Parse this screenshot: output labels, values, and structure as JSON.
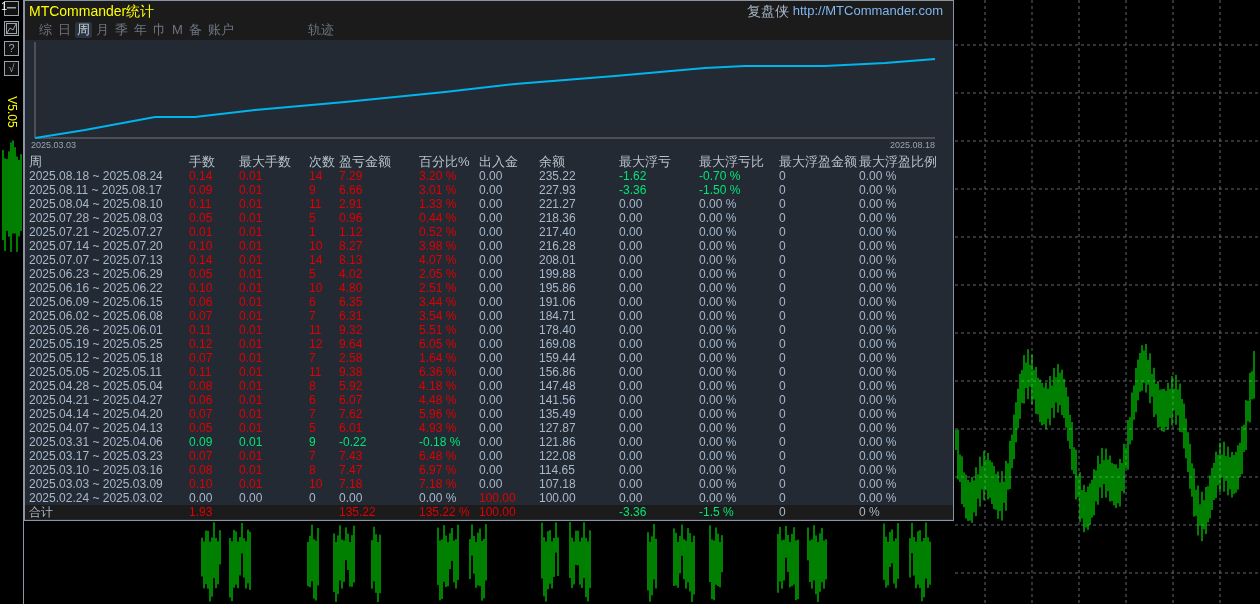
{
  "app": {
    "title": "MTCommander统计",
    "brand": "复盘侠",
    "link": "http://MTCommander.com",
    "version": "V5.05",
    "corner_label": "1"
  },
  "toolbar": [
    {
      "kind": "minimize"
    },
    {
      "kind": "image"
    },
    {
      "kind": "text",
      "label": "?"
    },
    {
      "kind": "text",
      "label": "√"
    }
  ],
  "tabs": [
    {
      "label": "综",
      "selected": false
    },
    {
      "label": "日",
      "selected": false
    },
    {
      "label": "周",
      "selected": true
    },
    {
      "label": "月",
      "selected": false
    },
    {
      "label": "季",
      "selected": false
    },
    {
      "label": "年",
      "selected": false
    },
    {
      "label": "巾",
      "selected": false
    },
    {
      "label": "M",
      "selected": false
    },
    {
      "label": "备",
      "selected": false
    },
    {
      "label": "账户",
      "selected": false
    },
    {
      "label": "轨迹",
      "selected": false,
      "kind": "far"
    }
  ],
  "equity_chart": {
    "start_label": "2025.03.03",
    "end_label": "2025.08.18"
  },
  "table": {
    "columns": [
      "周",
      "手数",
      "最大手数",
      "次数",
      "盈亏金额",
      "百分比%",
      "出入金",
      "余额",
      "最大浮亏",
      "最大浮亏比",
      "最大浮盈金额",
      "最大浮盈比例"
    ],
    "rows": [
      {
        "kind": "profit",
        "deposit": false,
        "floating_loss": true,
        "cells": [
          "2025.08.18 ~ 2025.08.24",
          "0.14",
          "0.01",
          "14",
          "7.29",
          "3.20 %",
          "0.00",
          "235.22",
          "-1.62",
          "-0.70 %",
          "0",
          "0.00 %"
        ]
      },
      {
        "kind": "profit",
        "deposit": false,
        "floating_loss": true,
        "cells": [
          "2025.08.11 ~ 2025.08.17",
          "0.09",
          "0.01",
          "9",
          "6.66",
          "3.01 %",
          "0.00",
          "227.93",
          "-3.36",
          "-1.50 %",
          "0",
          "0.00 %"
        ]
      },
      {
        "kind": "profit",
        "deposit": false,
        "floating_loss": false,
        "cells": [
          "2025.08.04 ~ 2025.08.10",
          "0.11",
          "0.01",
          "11",
          "2.91",
          "1.33 %",
          "0.00",
          "221.27",
          "0.00",
          "0.00 %",
          "0",
          "0.00 %"
        ]
      },
      {
        "kind": "profit",
        "deposit": false,
        "floating_loss": false,
        "cells": [
          "2025.07.28 ~ 2025.08.03",
          "0.05",
          "0.01",
          "5",
          "0.96",
          "0.44 %",
          "0.00",
          "218.36",
          "0.00",
          "0.00 %",
          "0",
          "0.00 %"
        ]
      },
      {
        "kind": "profit",
        "deposit": false,
        "floating_loss": false,
        "cells": [
          "2025.07.21 ~ 2025.07.27",
          "0.01",
          "0.01",
          "1",
          "1.12",
          "0.52 %",
          "0.00",
          "217.40",
          "0.00",
          "0.00 %",
          "0",
          "0.00 %"
        ]
      },
      {
        "kind": "profit",
        "deposit": false,
        "floating_loss": false,
        "cells": [
          "2025.07.14 ~ 2025.07.20",
          "0.10",
          "0.01",
          "10",
          "8.27",
          "3.98 %",
          "0.00",
          "216.28",
          "0.00",
          "0.00 %",
          "0",
          "0.00 %"
        ]
      },
      {
        "kind": "profit",
        "deposit": false,
        "floating_loss": false,
        "cells": [
          "2025.07.07 ~ 2025.07.13",
          "0.14",
          "0.01",
          "14",
          "8.13",
          "4.07 %",
          "0.00",
          "208.01",
          "0.00",
          "0.00 %",
          "0",
          "0.00 %"
        ]
      },
      {
        "kind": "profit",
        "deposit": false,
        "floating_loss": false,
        "cells": [
          "2025.06.23 ~ 2025.06.29",
          "0.05",
          "0.01",
          "5",
          "4.02",
          "2.05 %",
          "0.00",
          "199.88",
          "0.00",
          "0.00 %",
          "0",
          "0.00 %"
        ]
      },
      {
        "kind": "profit",
        "deposit": false,
        "floating_loss": false,
        "cells": [
          "2025.06.16 ~ 2025.06.22",
          "0.10",
          "0.01",
          "10",
          "4.80",
          "2.51 %",
          "0.00",
          "195.86",
          "0.00",
          "0.00 %",
          "0",
          "0.00 %"
        ]
      },
      {
        "kind": "profit",
        "deposit": false,
        "floating_loss": false,
        "cells": [
          "2025.06.09 ~ 2025.06.15",
          "0.06",
          "0.01",
          "6",
          "6.35",
          "3.44 %",
          "0.00",
          "191.06",
          "0.00",
          "0.00 %",
          "0",
          "0.00 %"
        ]
      },
      {
        "kind": "profit",
        "deposit": false,
        "floating_loss": false,
        "cells": [
          "2025.06.02 ~ 2025.06.08",
          "0.07",
          "0.01",
          "7",
          "6.31",
          "3.54 %",
          "0.00",
          "184.71",
          "0.00",
          "0.00 %",
          "0",
          "0.00 %"
        ]
      },
      {
        "kind": "profit",
        "deposit": false,
        "floating_loss": false,
        "cells": [
          "2025.05.26 ~ 2025.06.01",
          "0.11",
          "0.01",
          "11",
          "9.32",
          "5.51 %",
          "0.00",
          "178.40",
          "0.00",
          "0.00 %",
          "0",
          "0.00 %"
        ]
      },
      {
        "kind": "profit",
        "deposit": false,
        "floating_loss": false,
        "cells": [
          "2025.05.19 ~ 2025.05.25",
          "0.12",
          "0.01",
          "12",
          "9.64",
          "6.05 %",
          "0.00",
          "169.08",
          "0.00",
          "0.00 %",
          "0",
          "0.00 %"
        ]
      },
      {
        "kind": "profit",
        "deposit": false,
        "floating_loss": false,
        "cells": [
          "2025.05.12 ~ 2025.05.18",
          "0.07",
          "0.01",
          "7",
          "2.58",
          "1.64 %",
          "0.00",
          "159.44",
          "0.00",
          "0.00 %",
          "0",
          "0.00 %"
        ]
      },
      {
        "kind": "profit",
        "deposit": false,
        "floating_loss": false,
        "cells": [
          "2025.05.05 ~ 2025.05.11",
          "0.11",
          "0.01",
          "11",
          "9.38",
          "6.36 %",
          "0.00",
          "156.86",
          "0.00",
          "0.00 %",
          "0",
          "0.00 %"
        ]
      },
      {
        "kind": "profit",
        "deposit": false,
        "floating_loss": false,
        "cells": [
          "2025.04.28 ~ 2025.05.04",
          "0.08",
          "0.01",
          "8",
          "5.92",
          "4.18 %",
          "0.00",
          "147.48",
          "0.00",
          "0.00 %",
          "0",
          "0.00 %"
        ]
      },
      {
        "kind": "profit",
        "deposit": false,
        "floating_loss": false,
        "cells": [
          "2025.04.21 ~ 2025.04.27",
          "0.06",
          "0.01",
          "6",
          "6.07",
          "4.48 %",
          "0.00",
          "141.56",
          "0.00",
          "0.00 %",
          "0",
          "0.00 %"
        ]
      },
      {
        "kind": "profit",
        "deposit": false,
        "floating_loss": false,
        "cells": [
          "2025.04.14 ~ 2025.04.20",
          "0.07",
          "0.01",
          "7",
          "7.62",
          "5.96 %",
          "0.00",
          "135.49",
          "0.00",
          "0.00 %",
          "0",
          "0.00 %"
        ]
      },
      {
        "kind": "profit",
        "deposit": false,
        "floating_loss": false,
        "cells": [
          "2025.04.07 ~ 2025.04.13",
          "0.05",
          "0.01",
          "5",
          "6.01",
          "4.93 %",
          "0.00",
          "127.87",
          "0.00",
          "0.00 %",
          "0",
          "0.00 %"
        ]
      },
      {
        "kind": "loss",
        "deposit": false,
        "floating_loss": false,
        "cells": [
          "2025.03.31 ~ 2025.04.06",
          "0.09",
          "0.01",
          "9",
          "-0.22",
          "-0.18 %",
          "0.00",
          "121.86",
          "0.00",
          "0.00 %",
          "0",
          "0.00 %"
        ]
      },
      {
        "kind": "profit",
        "deposit": false,
        "floating_loss": false,
        "cells": [
          "2025.03.17 ~ 2025.03.23",
          "0.07",
          "0.01",
          "7",
          "7.43",
          "6.48 %",
          "0.00",
          "122.08",
          "0.00",
          "0.00 %",
          "0",
          "0.00 %"
        ]
      },
      {
        "kind": "profit",
        "deposit": false,
        "floating_loss": false,
        "cells": [
          "2025.03.10 ~ 2025.03.16",
          "0.08",
          "0.01",
          "8",
          "7.47",
          "6.97 %",
          "0.00",
          "114.65",
          "0.00",
          "0.00 %",
          "0",
          "0.00 %"
        ]
      },
      {
        "kind": "profit",
        "deposit": false,
        "floating_loss": false,
        "cells": [
          "2025.03.03 ~ 2025.03.09",
          "0.10",
          "0.01",
          "10",
          "7.18",
          "7.18 %",
          "0.00",
          "107.18",
          "0.00",
          "0.00 %",
          "0",
          "0.00 %"
        ]
      },
      {
        "kind": "flat",
        "deposit": true,
        "floating_loss": false,
        "cells": [
          "2025.02.24 ~ 2025.03.02",
          "0.00",
          "0.00",
          "0",
          "0.00",
          "0.00 %",
          "100.00",
          "100.00",
          "0.00",
          "0.00 %",
          "0",
          "0.00 %"
        ]
      }
    ],
    "total": {
      "label": "合计",
      "lots": "1.93",
      "profit": "135.22",
      "percent": "135.22 %",
      "deposit": "100.00",
      "max_float_loss": "-3.36",
      "max_float_loss_pct": "-1.5 %",
      "max_float_profit": "0",
      "max_float_profit_pct": "0 %"
    }
  }
}
